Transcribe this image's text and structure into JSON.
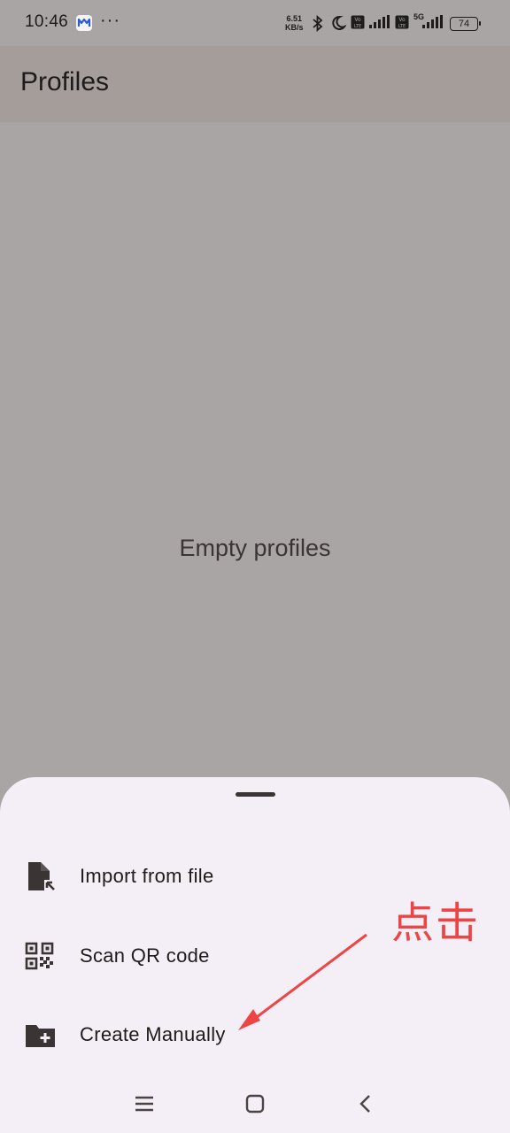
{
  "status_bar": {
    "time": "10:46",
    "net_speed_value": "6.51",
    "net_speed_unit": "KB/s",
    "network": "5G",
    "battery": "74",
    "icons": [
      "mail-app-icon",
      "more-dots-icon",
      "bluetooth-icon",
      "moon-icon",
      "volte-icon",
      "signal-icon",
      "battery-icon"
    ]
  },
  "app_bar": {
    "title": "Profiles"
  },
  "main": {
    "empty_message": "Empty profiles"
  },
  "sheet": {
    "options": [
      {
        "label": "Import from file",
        "icon": "file-import-icon"
      },
      {
        "label": "Scan QR code",
        "icon": "qr-code-icon"
      },
      {
        "label": "Create Manually",
        "icon": "folder-add-icon"
      }
    ]
  },
  "annotation": {
    "text": "点击",
    "color": "#ef4444"
  },
  "nav_bar": {
    "icons": [
      "menu-icon",
      "home-icon",
      "back-icon"
    ]
  }
}
